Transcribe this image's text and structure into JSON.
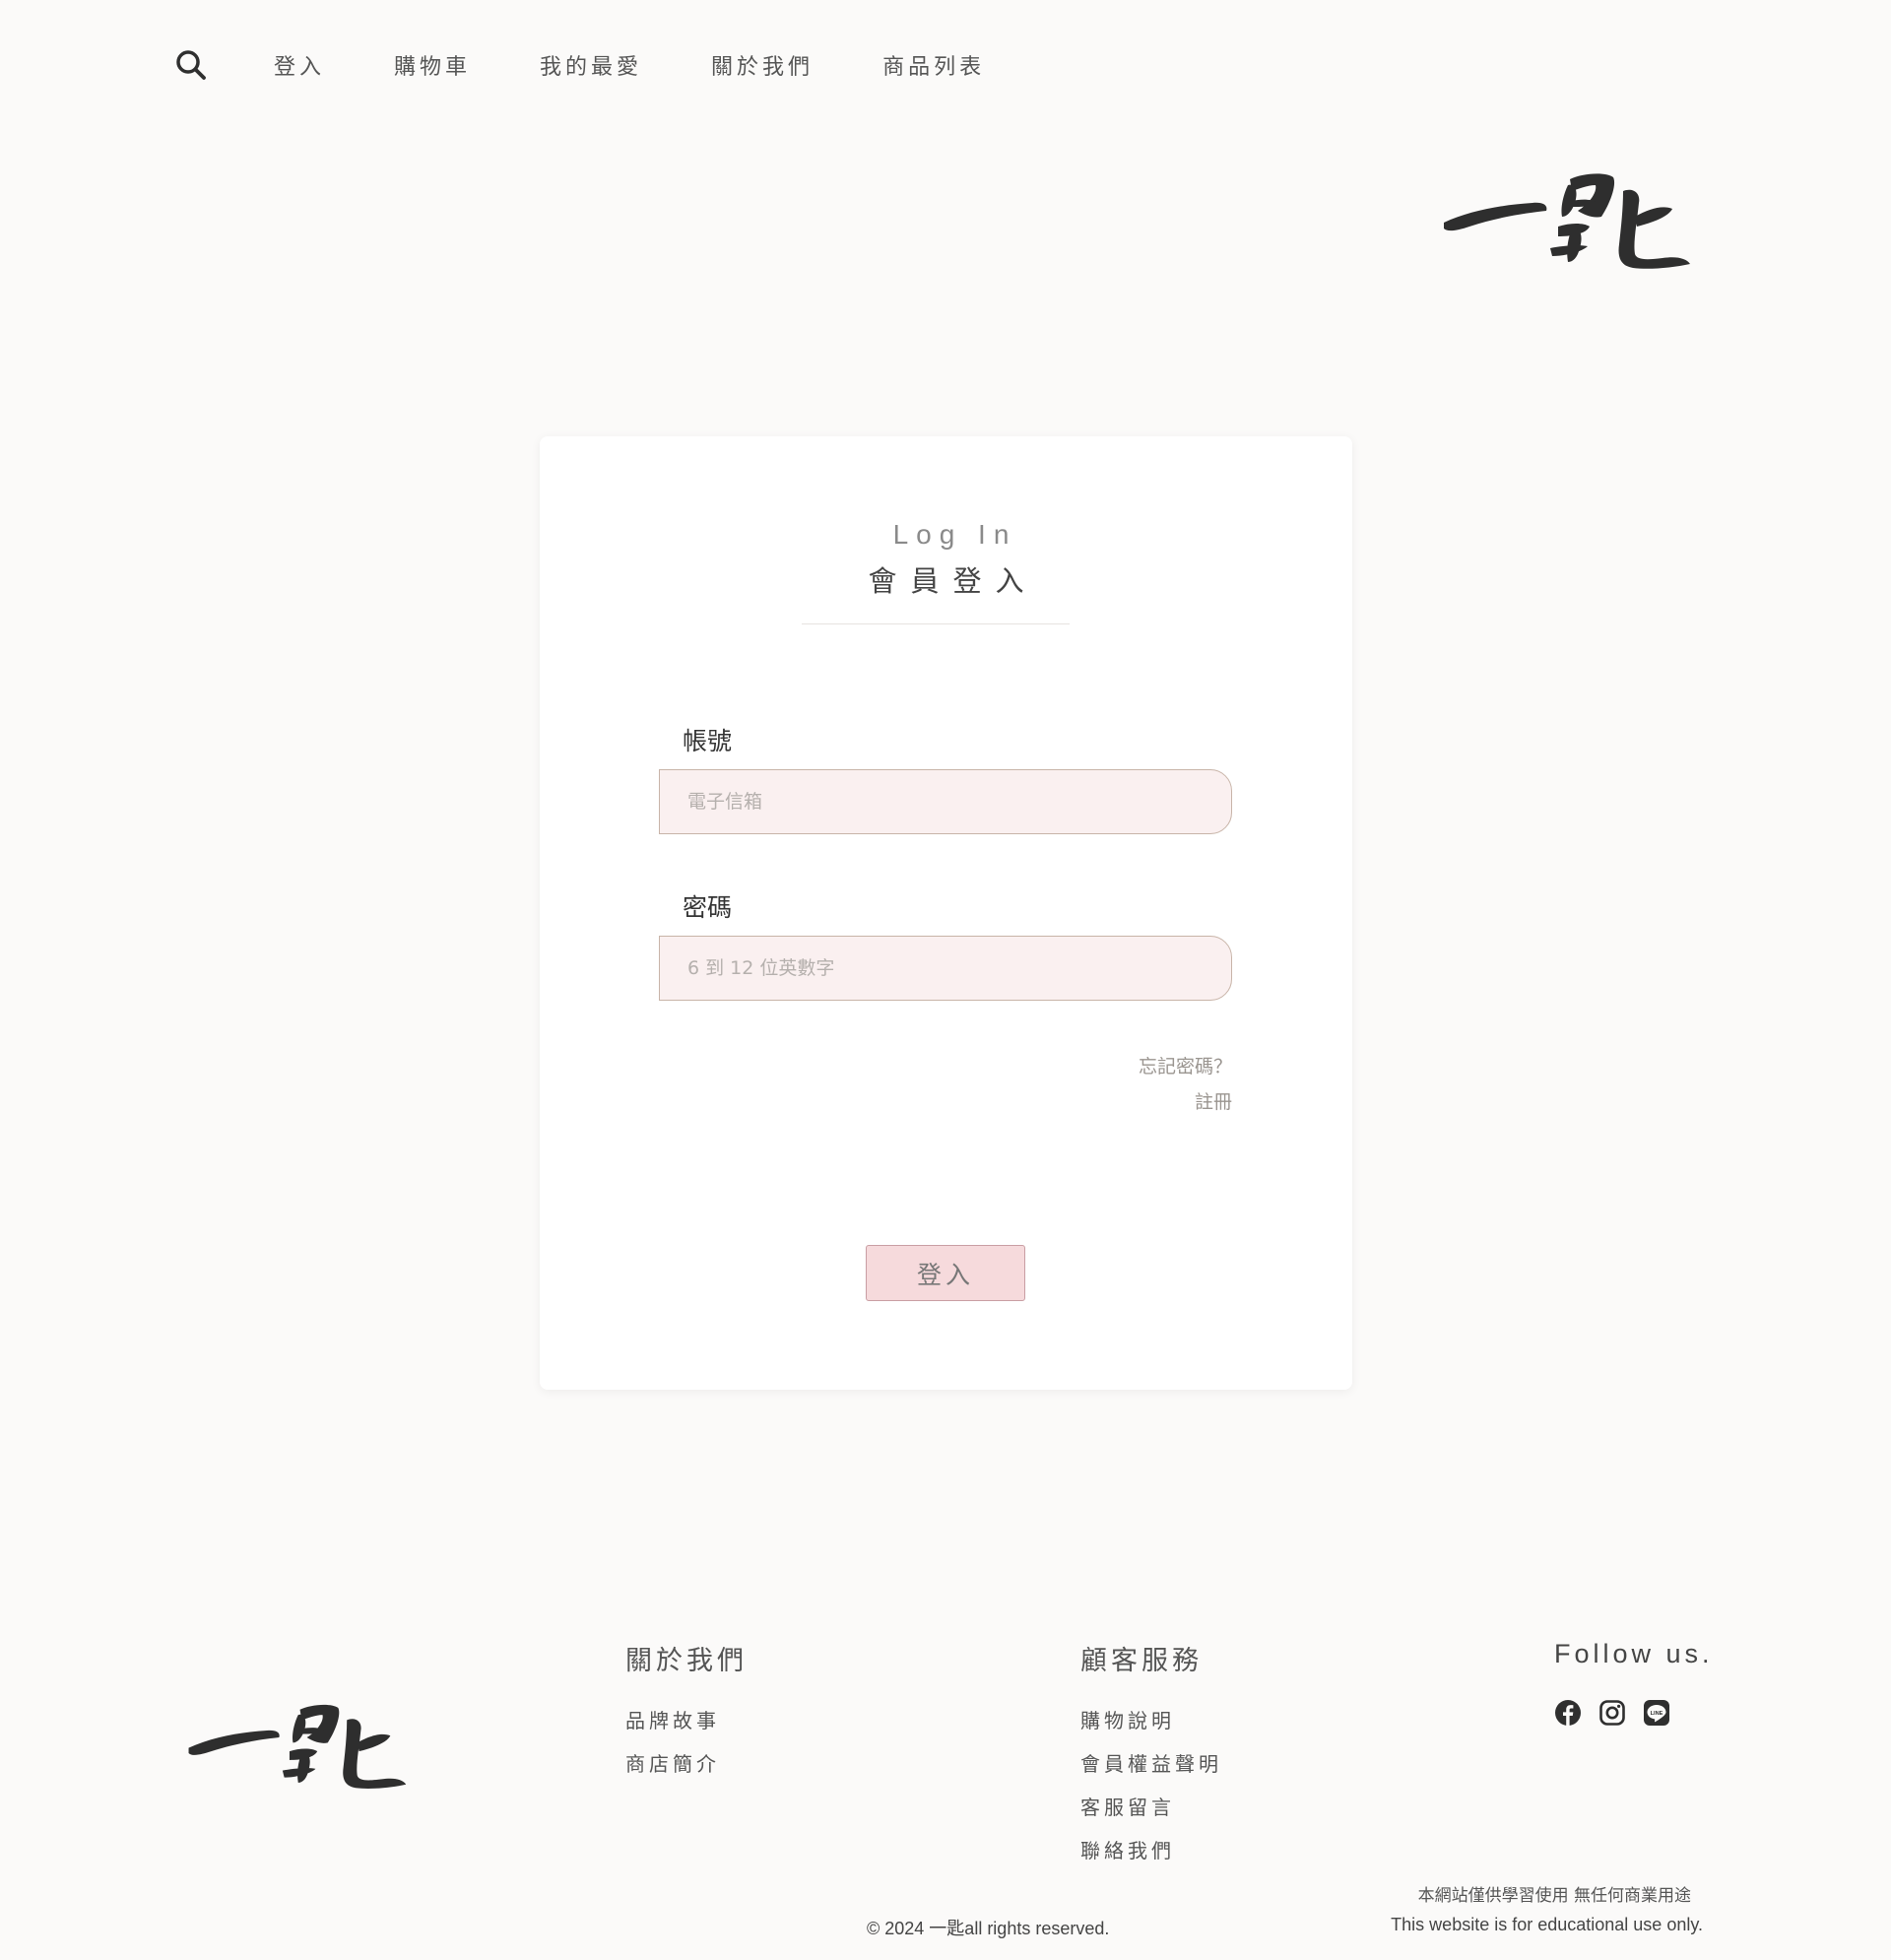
{
  "nav": {
    "search_icon": "search-icon",
    "links": [
      "登入",
      "購物車",
      "我的最愛",
      "關於我們",
      "商品列表"
    ]
  },
  "brand": {
    "logo_text": "一匙",
    "logo_color": "#2e2e2e"
  },
  "login": {
    "title_en": "Log In",
    "title_zh": "會員登入",
    "account_label": "帳號",
    "account_placeholder": "電子信箱",
    "account_value": "",
    "password_label": "密碼",
    "password_placeholder": "6 到 12 位英數字",
    "password_value": "",
    "forgot_link": "忘記密碼？",
    "register_link": "註冊",
    "submit_label": "登入"
  },
  "footer": {
    "about": {
      "heading": "關於我們",
      "links": [
        "品牌故事",
        "商店簡介"
      ]
    },
    "service": {
      "heading": "顧客服務",
      "links": [
        "購物說明",
        "會員權益聲明",
        "客服留言",
        "聯絡我們"
      ]
    },
    "follow": {
      "heading": "Follow us.",
      "icons": [
        "facebook-icon",
        "instagram-icon",
        "line-icon"
      ]
    },
    "copyright": "© 2024 一匙all rights reserved.",
    "disclaimer_zh": "本網站僅供學習使用 無任何商業用途",
    "disclaimer_en": "This website is for educational use only."
  },
  "colors": {
    "background": "#fbfaf9",
    "input_fill": "#faf0f0",
    "input_border": "#c8b4a8",
    "button_fill": "#f6dadc",
    "button_border": "#c99ea3"
  }
}
